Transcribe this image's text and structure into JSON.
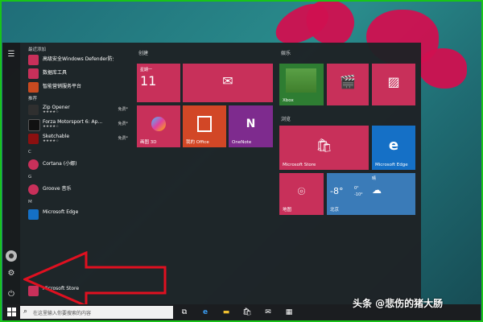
{
  "left_rail": {
    "menu_icon": "hamburger-icon",
    "avatar_icon": "user-icon",
    "power_icon": "power-icon"
  },
  "app_list": {
    "recent_header": "最近添加",
    "recent": [
      {
        "name": "高级安全Windows Defender防火墙",
        "color": "#c8305a"
      },
      {
        "name": "数据库工具",
        "color": "#c8305a"
      },
      {
        "name": "智能营销服务平台",
        "color": "#c84a20"
      }
    ],
    "suggest_header": "推荐",
    "suggest": [
      {
        "name": "Zip Opener",
        "rating": "★★★★☆",
        "tag": "免费*",
        "color": "#2f2f2f"
      },
      {
        "name": "Forza Motorsport 6: Ap...",
        "rating": "★★★★☆",
        "tag": "免费*",
        "color": "#111111"
      },
      {
        "name": "Sketchable",
        "rating": "★★★★☆",
        "tag": "免费*",
        "color": "#8b1010"
      }
    ],
    "letter_c": "C",
    "cortana": "Cortana (小娜)",
    "letter_g": "G",
    "groove": "Groove 音乐",
    "letter_m": "M",
    "microsoft_edge": "Microsoft Edge",
    "microsoft_store": "Microsoft Store"
  },
  "tiles": {
    "create_header": "创建",
    "play_header": "娱乐",
    "browse_header": "浏览",
    "calendar": {
      "weekday": "星期一",
      "day": "11"
    },
    "mail_icon": "mail-icon",
    "paint3d": "画图 3D",
    "office": "我的 Office",
    "onenote": "OneNote",
    "xbox": "Xbox",
    "movies_icon": "film-icon",
    "photos_icon": "photo-icon",
    "store": "Microsoft Store",
    "edge": "Microsoft Edge",
    "maps": "地图",
    "weather": {
      "condition": "晴",
      "temp": "-8°",
      "high": "0°",
      "low": "-10°",
      "city": "北京"
    }
  },
  "taskbar": {
    "search_placeholder": "在这里输入你要搜索的内容",
    "icons": [
      "task-view-icon",
      "edge-icon",
      "file-explorer-icon",
      "store-icon",
      "mail-icon",
      "calculator-icon"
    ]
  },
  "watermark": "头条 @悲伤的猪大肠",
  "colors": {
    "tile": "#c8305a",
    "office": "#d24726",
    "onenote": "#7e2b8e",
    "edge": "#1570c6",
    "taskbar": "#1b1d20",
    "arrow": "#e01020"
  }
}
